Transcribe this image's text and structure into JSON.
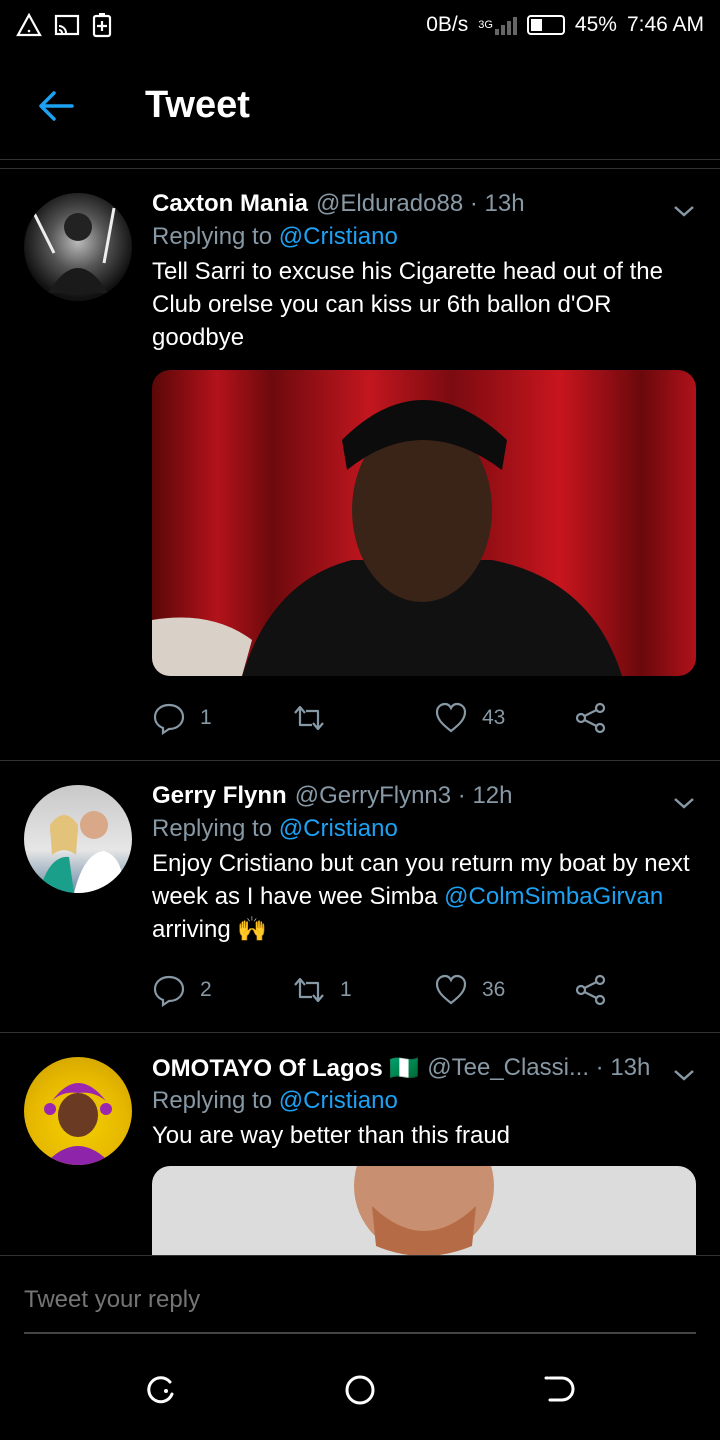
{
  "status": {
    "speed": "0B/s",
    "network": "3G",
    "battery": "45%",
    "battery_level": 0.45,
    "time": "7:46 AM"
  },
  "header": {
    "title": "Tweet"
  },
  "tweets": [
    {
      "name": "Caxton Mania",
      "handle": "@Eldurado88",
      "time": "· 13h",
      "replying_prefix": "Replying to",
      "replying_to": "@Cristiano",
      "text": "Tell Sarri to excuse his Cigarette head out of the Club orelse you can kiss ur 6th ballon d'OR goodbye",
      "replies": "1",
      "retweets": "",
      "likes": "43"
    },
    {
      "name": "Gerry Flynn",
      "handle": "@GerryFlynn3",
      "time": "· 12h",
      "replying_prefix": "Replying to",
      "replying_to": "@Cristiano",
      "text_before": "Enjoy Cristiano but can you return my boat by next week as I have wee Simba ",
      "mention": "@ColmSimbaGirvan",
      "text_after": " arriving 🙌",
      "replies": "2",
      "retweets": "1",
      "likes": "36"
    },
    {
      "name": "OMOTAYO Of Lagos 🇳🇬",
      "handle": "@Tee_Classi...",
      "time": "· 13h",
      "replying_prefix": "Replying to",
      "replying_to": "@Cristiano",
      "text": "You are way better than this fraud"
    }
  ],
  "reply_bar": {
    "placeholder": "Tweet your reply"
  },
  "colors": {
    "accent": "#1da1f2",
    "muted": "#8899a6",
    "background": "#000000"
  }
}
